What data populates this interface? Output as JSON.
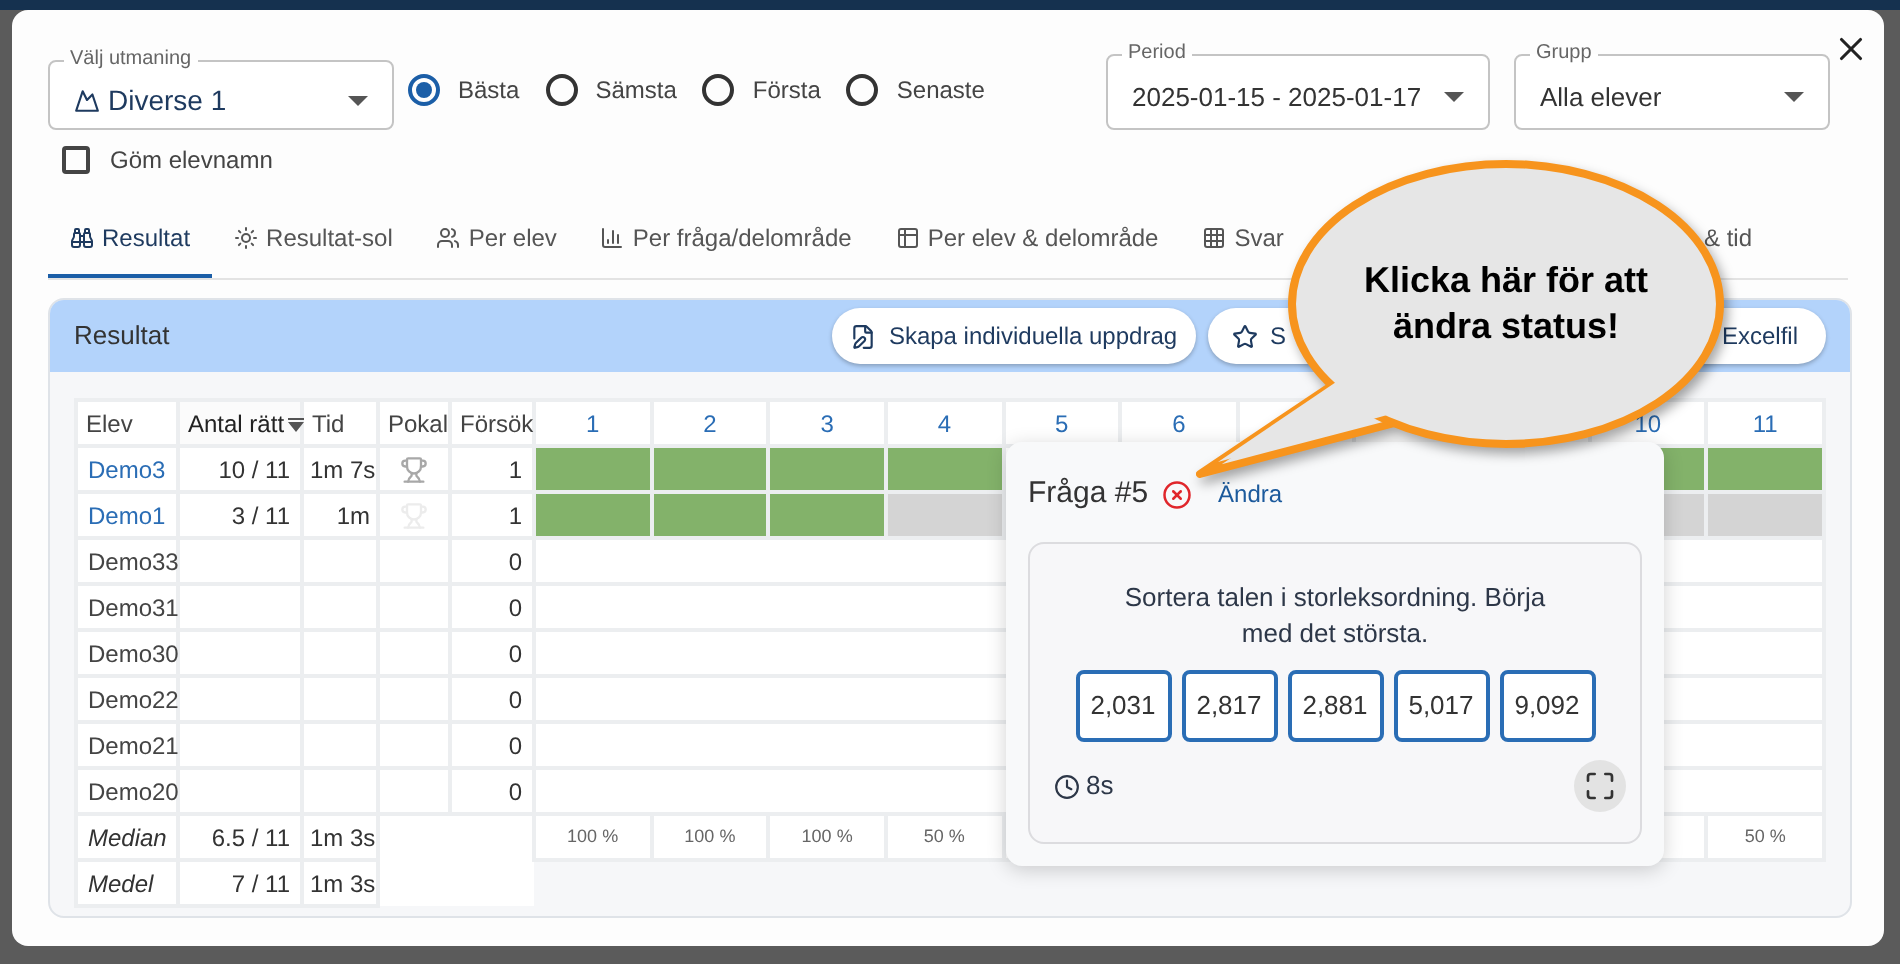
{
  "challenge_select": {
    "label": "Välj utmaning",
    "value": "Diverse 1"
  },
  "ranking_options": [
    {
      "label": "Bästa",
      "selected": true
    },
    {
      "label": "Sämsta",
      "selected": false
    },
    {
      "label": "Första",
      "selected": false
    },
    {
      "label": "Senaste",
      "selected": false
    }
  ],
  "hide_names": {
    "label": "Göm elevnamn",
    "checked": false
  },
  "period_select": {
    "label": "Period",
    "value": "2025-01-15 - 2025-01-17"
  },
  "group_select": {
    "label": "Grupp",
    "value": "Alla elever"
  },
  "tabs": [
    {
      "label": "Resultat",
      "kind": "binoculars",
      "selected": true
    },
    {
      "label": "Resultat-sol",
      "kind": "sun",
      "selected": false
    },
    {
      "label": "Per elev",
      "kind": "seats",
      "selected": false
    },
    {
      "label": "Per fråga/delområde",
      "kind": "chart",
      "selected": false
    },
    {
      "label": "Per elev & delområde",
      "kind": "table",
      "selected": false
    },
    {
      "label": "Svar",
      "kind": "grid",
      "selected": false
    },
    {
      "label": "& tid",
      "kind": "none",
      "selected": false
    }
  ],
  "panel": {
    "title": "Resultat",
    "buttons": [
      {
        "label": "Skapa individuella uppdrag",
        "kind": "assign"
      },
      {
        "label": "S",
        "kind": "star"
      },
      {
        "label": "Excelfil",
        "kind": "plain"
      }
    ]
  },
  "table": {
    "columns": [
      {
        "label": "Elev",
        "sorted": false
      },
      {
        "label": "Antal rätt",
        "sorted": true
      },
      {
        "label": "Tid",
        "sorted": false
      },
      {
        "label": "Pokal",
        "sorted": false
      },
      {
        "label": "Försök",
        "sorted": false
      }
    ],
    "question_columns": [
      "1",
      "2",
      "3",
      "4",
      "5",
      "6"
    ],
    "question_columns_end": [
      "10",
      "11"
    ],
    "rows": [
      {
        "name": "Demo3",
        "linked": true,
        "score": "10 / 11",
        "time": "1m 7s",
        "trophy_earned": true,
        "attempts": "1",
        "results": [
          {
            "correct": true
          },
          {
            "correct": true
          },
          {
            "correct": true
          },
          {
            "correct": true
          }
        ],
        "results_end": [
          {
            "correct": true
          },
          {
            "correct": true
          }
        ]
      },
      {
        "name": "Demo1",
        "linked": true,
        "score": "3 / 11",
        "time": "1m",
        "trophy_earned": false,
        "attempts": "1",
        "results": [
          {
            "correct": true
          },
          {
            "correct": true
          },
          {
            "correct": true
          },
          {
            "correct": false
          }
        ],
        "results_end": [
          {
            "correct": false
          },
          {
            "correct": false
          }
        ]
      },
      {
        "name": "Demo33",
        "linked": false,
        "attempts": "0"
      },
      {
        "name": "Demo31",
        "linked": false,
        "attempts": "0"
      },
      {
        "name": "Demo30",
        "linked": false,
        "attempts": "0"
      },
      {
        "name": "Demo22",
        "linked": false,
        "attempts": "0"
      },
      {
        "name": "Demo21",
        "linked": false,
        "attempts": "0"
      },
      {
        "name": "Demo20",
        "linked": false,
        "attempts": "0"
      }
    ],
    "summary": [
      {
        "label": "Median",
        "score": "6.5 / 11",
        "time": "1m 3s",
        "question_stats": [
          "100 %",
          "100 %",
          "100 %",
          "50 %"
        ],
        "question_stats_end": [
          "50 %"
        ]
      },
      {
        "label": "Medel",
        "score": "7 / 11",
        "time": "1m 3s"
      }
    ]
  },
  "question_popup": {
    "title": "Fråga #5",
    "correct": false,
    "action": "Ändra",
    "question": "Sortera talen i storleksordning. Börja med det största.",
    "answers": [
      "2,031",
      "2,817",
      "2,881",
      "5,017",
      "9,092"
    ],
    "duration": "8s"
  },
  "callout": {
    "text": "Klicka här för att ändra status!"
  }
}
